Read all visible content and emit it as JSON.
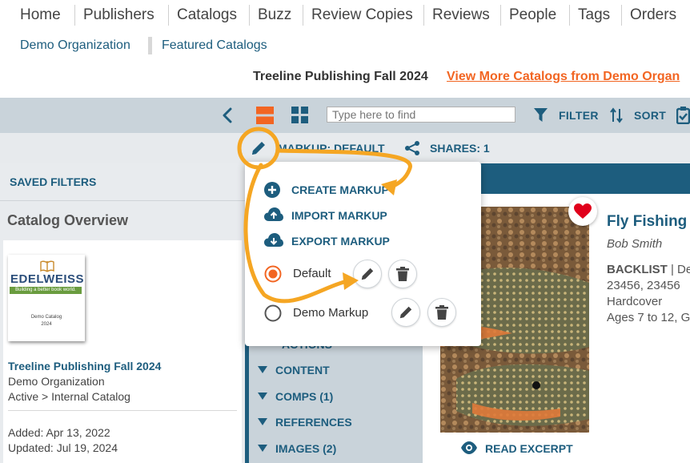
{
  "nav": {
    "items": [
      "Home",
      "Publishers",
      "Catalogs",
      "Buzz",
      "Review Copies",
      "Reviews",
      "People",
      "Tags",
      "Orders"
    ]
  },
  "subnav": {
    "items": [
      "Demo Organization",
      "Featured Catalogs"
    ]
  },
  "catalog_header": {
    "title": "Treeline Publishing Fall 2024",
    "more_link": "View More Catalogs from Demo Organ"
  },
  "toolbar": {
    "search_placeholder": "Type here to find",
    "filter_label": "FILTER",
    "sort_label": "SORT"
  },
  "markup_bar": {
    "markup_label": "MARKUP: DEFAULT",
    "shares_label": "SHARES: 1"
  },
  "left_panel": {
    "saved_filters": "SAVED FILTERS",
    "catalog_overview": "Catalog Overview",
    "cover": {
      "logo": "EDELWEISS",
      "tagline": "Building a better book world.",
      "caption_line1": "Demo Catalog",
      "caption_line2": "2024"
    },
    "card": {
      "title": "Treeline Publishing Fall 2024",
      "organization": "Demo Organization",
      "status": "Active > Internal Catalog",
      "added": "Added: Apr 13, 2022",
      "updated": "Updated: Jul 19, 2024"
    }
  },
  "sections": {
    "partial_label": "ACTIONS",
    "items": [
      "CONTENT",
      "COMPS (1)",
      "REFERENCES",
      "IMAGES (2)"
    ]
  },
  "book": {
    "title": "Fly Fishing f",
    "author": "Bob Smith",
    "format_label": "BACKLIST",
    "format_sep": " | De",
    "isbns": "23456, 23456",
    "binding": "Hardcover",
    "ages": "Ages 7 to 12, G",
    "read_excerpt": "READ EXCERPT"
  },
  "dropdown": {
    "create": "CREATE MARKUP",
    "import": "IMPORT MARKUP",
    "export": "EXPORT MARKUP",
    "markups": [
      {
        "label": "Default",
        "selected": true
      },
      {
        "label": "Demo Markup",
        "selected": false
      }
    ]
  },
  "colors": {
    "brand_blue": "#1d5d7e",
    "accent_orange": "#f26522",
    "annotation_orange": "#f5a623",
    "toolbar_bg": "#c9d3da"
  }
}
